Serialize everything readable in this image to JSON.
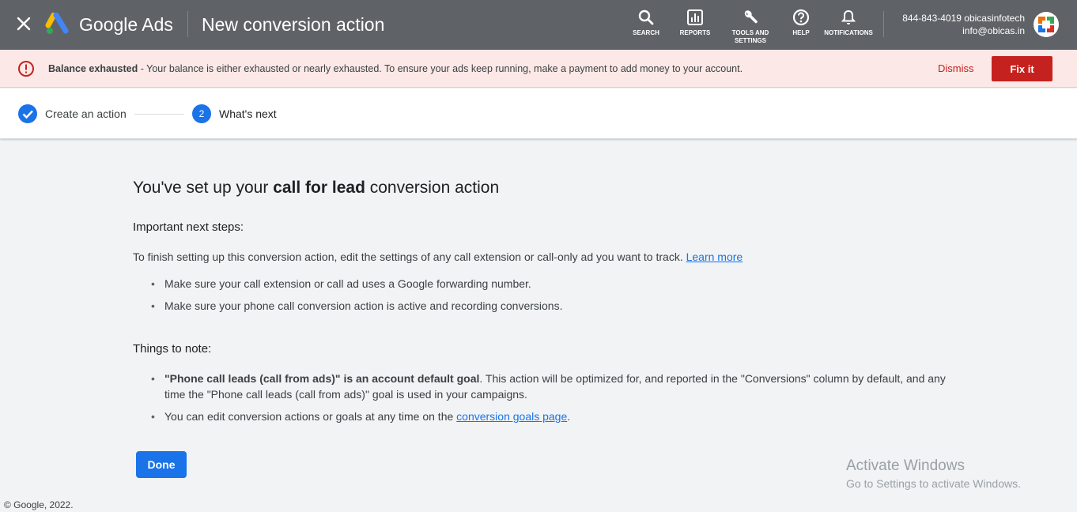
{
  "header": {
    "brand": "Google Ads",
    "title": "New conversion action",
    "tools": [
      {
        "label": "SEARCH",
        "icon": "search-icon"
      },
      {
        "label": "REPORTS",
        "icon": "reports-icon"
      },
      {
        "label_line1": "TOOLS AND",
        "label_line2": "SETTINGS",
        "icon": "wrench-icon"
      },
      {
        "label": "HELP",
        "icon": "help-icon"
      },
      {
        "label": "NOTIFICATIONS",
        "icon": "bell-icon"
      }
    ],
    "account": {
      "line1": "844-843-4019 obicasinfotech",
      "line2": "info@obicas.in"
    }
  },
  "alert": {
    "title": "Balance exhausted",
    "message": " - Your balance is either exhausted or nearly exhausted. To ensure your ads keep running, make a payment to add money to your account.",
    "dismiss": "Dismiss",
    "action": "Fix it"
  },
  "stepper": {
    "steps": [
      {
        "label": "Create an action",
        "status": "complete"
      },
      {
        "number": "2",
        "label": "What's next",
        "status": "current"
      }
    ]
  },
  "main": {
    "heading_prefix": "You've set up your ",
    "heading_bold": "call for lead",
    "heading_suffix": " conversion action",
    "section1_title": "Important next steps:",
    "section1_intro": "To finish setting up this conversion action, edit the settings of any call extension or call-only ad you want to track. ",
    "learn_more": "Learn more",
    "section1_items": [
      "Make sure your call extension or call ad uses a Google forwarding number.",
      "Make sure your phone call conversion action is active and recording conversions."
    ],
    "section2_title": "Things to note:",
    "note1_bold": "\"Phone call leads (call from ads)\" is an account default goal",
    "note1_text": ". This action will be optimized for, and reported in the \"Conversions\" column by default, and any time the \"Phone call leads (call from ads)\" goal is used in your campaigns.",
    "note2_text": "You can edit conversion actions or goals at any time on the ",
    "note2_link": "conversion goals page",
    "note2_end": ".",
    "done": "Done"
  },
  "watermark": {
    "line1": "Activate Windows",
    "line2": "Go to Settings to activate Windows."
  },
  "footer": "© Google, 2022.",
  "colors": {
    "topbar": "#5f6368",
    "alert_bg": "#fce8e6",
    "danger": "#c5221f",
    "primary": "#1a73e8"
  }
}
